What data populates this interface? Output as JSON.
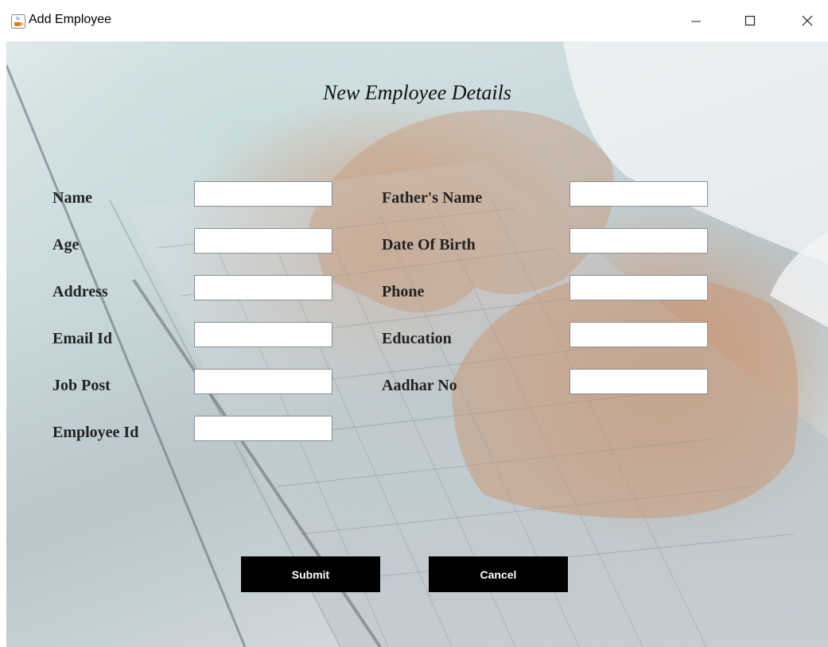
{
  "window": {
    "title": "Add Employee"
  },
  "form": {
    "heading": "New Employee Details",
    "left_fields": [
      {
        "label": "Name",
        "value": ""
      },
      {
        "label": "Age",
        "value": ""
      },
      {
        "label": "Address",
        "value": ""
      },
      {
        "label": "Email Id",
        "value": ""
      },
      {
        "label": "Job Post",
        "value": ""
      },
      {
        "label": "Employee Id",
        "value": ""
      }
    ],
    "right_fields": [
      {
        "label": "Father's Name",
        "value": ""
      },
      {
        "label": "Date Of Birth",
        "value": ""
      },
      {
        "label": "Phone",
        "value": ""
      },
      {
        "label": "Education",
        "value": ""
      },
      {
        "label": "Aadhar No",
        "value": ""
      }
    ]
  },
  "actions": {
    "submit_label": "Submit",
    "cancel_label": "Cancel"
  },
  "icons": {
    "app": "java-coffee-cup-icon",
    "minimize": "minimize-icon",
    "maximize": "maximize-icon",
    "close": "close-icon"
  }
}
